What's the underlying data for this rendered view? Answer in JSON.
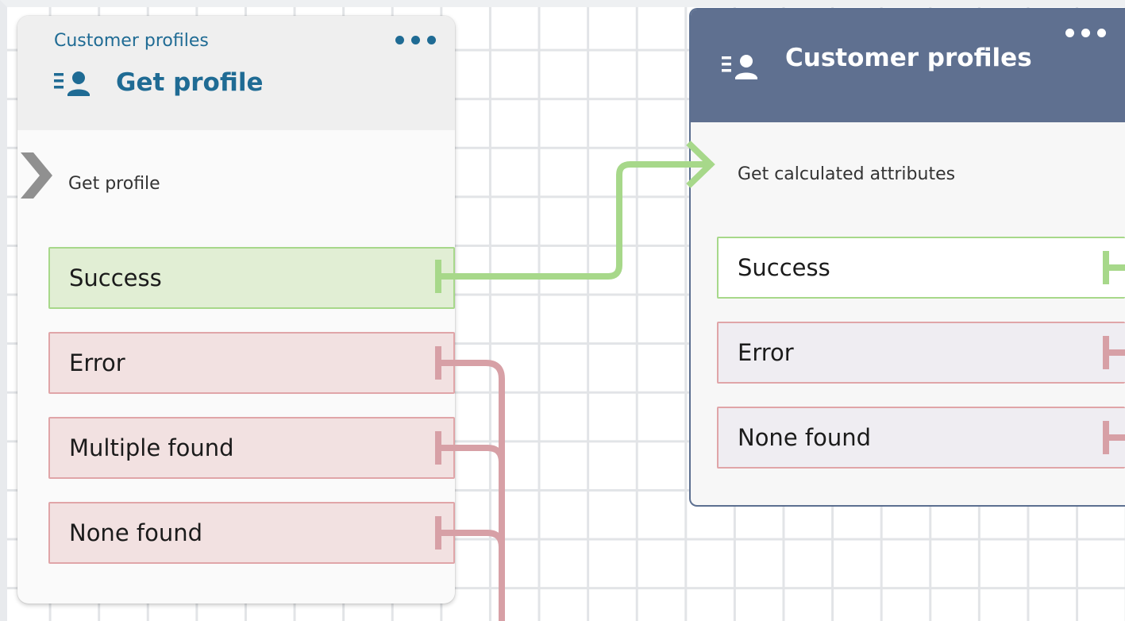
{
  "colors": {
    "canvas_grid": "#e2e4e7",
    "accent_blue": "#1f6b94",
    "header_slate": "#5f7090",
    "success_green": "#a7d88a",
    "error_pink": "#e0a5a8",
    "connector_gray": "#909090"
  },
  "blocks": [
    {
      "type_label": "Customer profiles",
      "title": "Get profile",
      "icon": "customer-profile-icon",
      "menu_icon": "more-options-icon",
      "input_label": "Get profile",
      "branches": [
        "Success",
        "Error",
        "Multiple found",
        "None found"
      ]
    },
    {
      "title": "Customer profiles",
      "icon": "customer-profile-icon",
      "menu_icon": "more-options-icon",
      "input_label": "Get calculated attributes",
      "branches": [
        "Success",
        "Error",
        "None found"
      ]
    }
  ]
}
